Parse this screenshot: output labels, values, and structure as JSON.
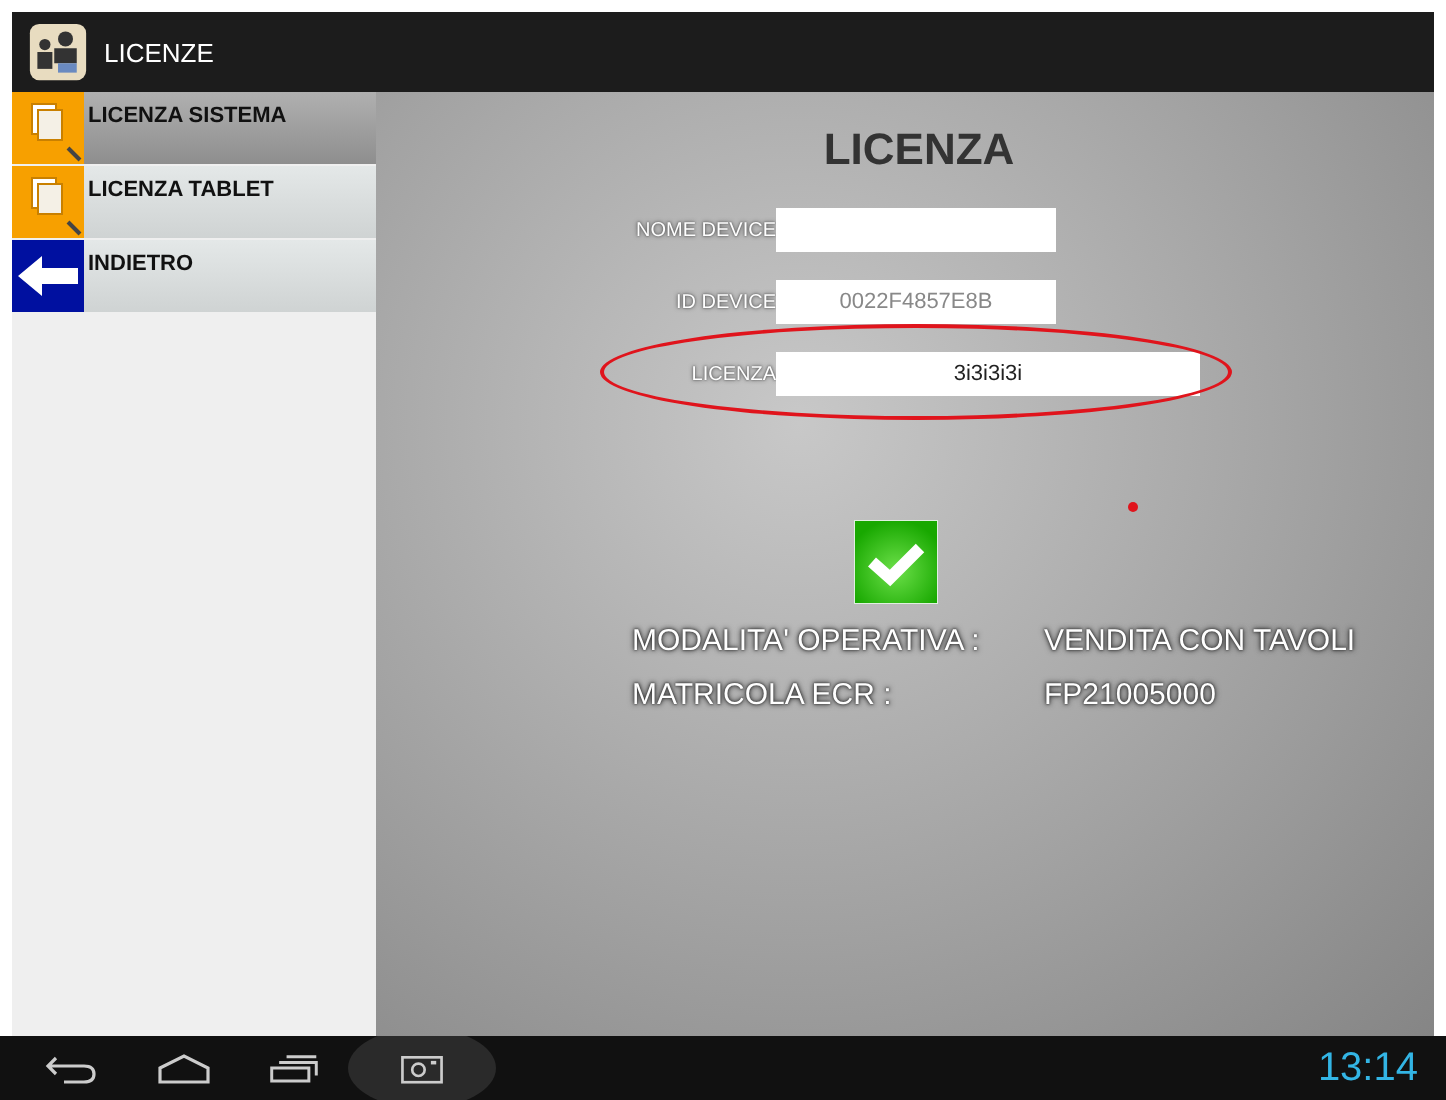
{
  "app_bar": {
    "title": "LICENZE"
  },
  "menu": [
    {
      "label": "LICENZA SISTEMA",
      "kind": "document",
      "selected": true
    },
    {
      "label": "LICENZA TABLET",
      "kind": "document",
      "selected": false
    },
    {
      "label": "INDIETRO",
      "kind": "back",
      "selected": false
    }
  ],
  "heading": "LICENZA",
  "fields": [
    {
      "label": "NOME DEVICE",
      "highlighted": false
    },
    {
      "label": "ID DEVICE",
      "value": "0022F4857E8B",
      "highlighted": false
    },
    {
      "label": "LICENZA",
      "value": "3i3i3i3i",
      "highlighted": true
    }
  ],
  "status_valid": true,
  "info": [
    {
      "label": "MODALITA' OPERATIVA :",
      "value": "VENDITA CON TAVOLI"
    },
    {
      "label": "MATRICOLA ECR :",
      "value": "FP21005000"
    }
  ],
  "nav_bar": {
    "clock": "13:14"
  }
}
